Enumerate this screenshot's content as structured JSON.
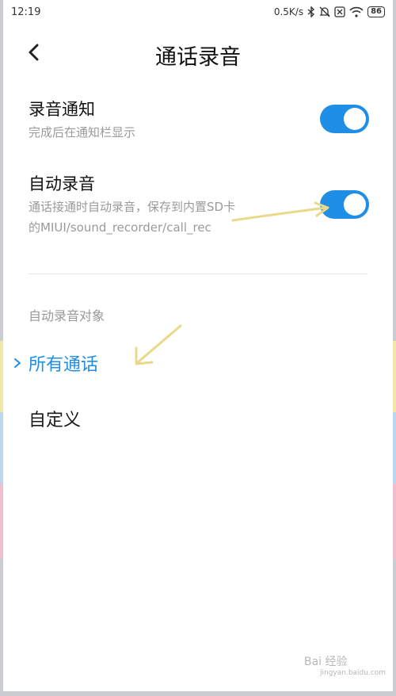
{
  "status": {
    "time": "12:19",
    "speed": "0.5K/s",
    "battery": "86"
  },
  "header": {
    "title": "通话录音"
  },
  "settings": [
    {
      "title": "录音通知",
      "desc_line1": "完成后在通知栏显示",
      "desc_line2": "",
      "enabled": true
    },
    {
      "title": "自动录音",
      "desc_line1": "通话接通时自动录音，保存到内置SD卡",
      "desc_line2": "的MIUI/sound_recorder/call_rec",
      "enabled": true
    }
  ],
  "section": {
    "header": "自动录音对象",
    "options": [
      {
        "label": "所有通话",
        "selected": true
      },
      {
        "label": "自定义",
        "selected": false
      }
    ]
  },
  "watermark": {
    "text": "Bai 经验",
    "sub": "jingyan.baidu.com"
  },
  "colors": {
    "accent": "#1e8ee6",
    "annotation_arrow": "#e9d98a"
  },
  "icons": [
    "back-arrow-icon",
    "bluetooth-icon",
    "mute-icon",
    "sim-icon",
    "wifi-icon",
    "chevron-right-icon"
  ]
}
